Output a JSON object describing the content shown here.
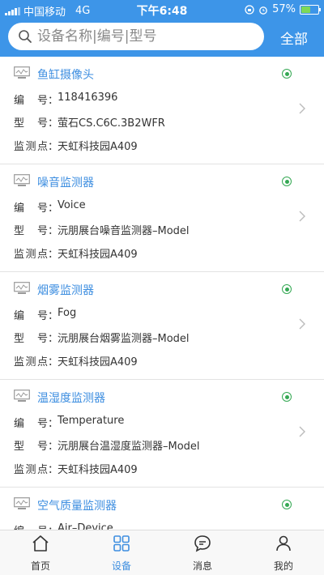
{
  "status_bar": {
    "carrier": "中国移动",
    "network": "4G",
    "time": "下午6:48",
    "battery": "57%",
    "battery_level": 0.57
  },
  "search": {
    "placeholder": "设备名称|编号|型号",
    "filter_label": "全部"
  },
  "labels": {
    "number_chars": [
      "编",
      "号"
    ],
    "model_chars": [
      "型",
      "号"
    ],
    "location_chars": [
      "监",
      "测",
      "点"
    ],
    "colon": "："
  },
  "devices": [
    {
      "name": "鱼缸摄像头",
      "number": "118416396",
      "model": "萤石CS.C6C.3B2WFR",
      "location": "天虹科技园A409",
      "status": "online"
    },
    {
      "name": "噪音监测器",
      "number": "Voice",
      "model": "沅朋展台噪音监测器–Model",
      "location": "天虹科技园A409",
      "status": "online"
    },
    {
      "name": "烟雾监测器",
      "number": "Fog",
      "model": "沅朋展台烟雾监测器–Model",
      "location": "天虹科技园A409",
      "status": "online"
    },
    {
      "name": "温湿度监测器",
      "number": "Temperature",
      "model": "沅朋展台温湿度监测器–Model",
      "location": "天虹科技园A409",
      "status": "online"
    },
    {
      "name": "空气质量监测器",
      "number": "Air–Device",
      "model": "",
      "location": "",
      "status": "online"
    }
  ],
  "tabs": [
    {
      "label": "首页",
      "icon": "home-icon",
      "active": false
    },
    {
      "label": "设备",
      "icon": "grid-icon",
      "active": true
    },
    {
      "label": "消息",
      "icon": "message-icon",
      "active": false
    },
    {
      "label": "我的",
      "icon": "user-icon",
      "active": false
    }
  ],
  "colors": {
    "accent": "#3d95e8",
    "device_name": "#3d8ee0",
    "online": "#34a853"
  }
}
